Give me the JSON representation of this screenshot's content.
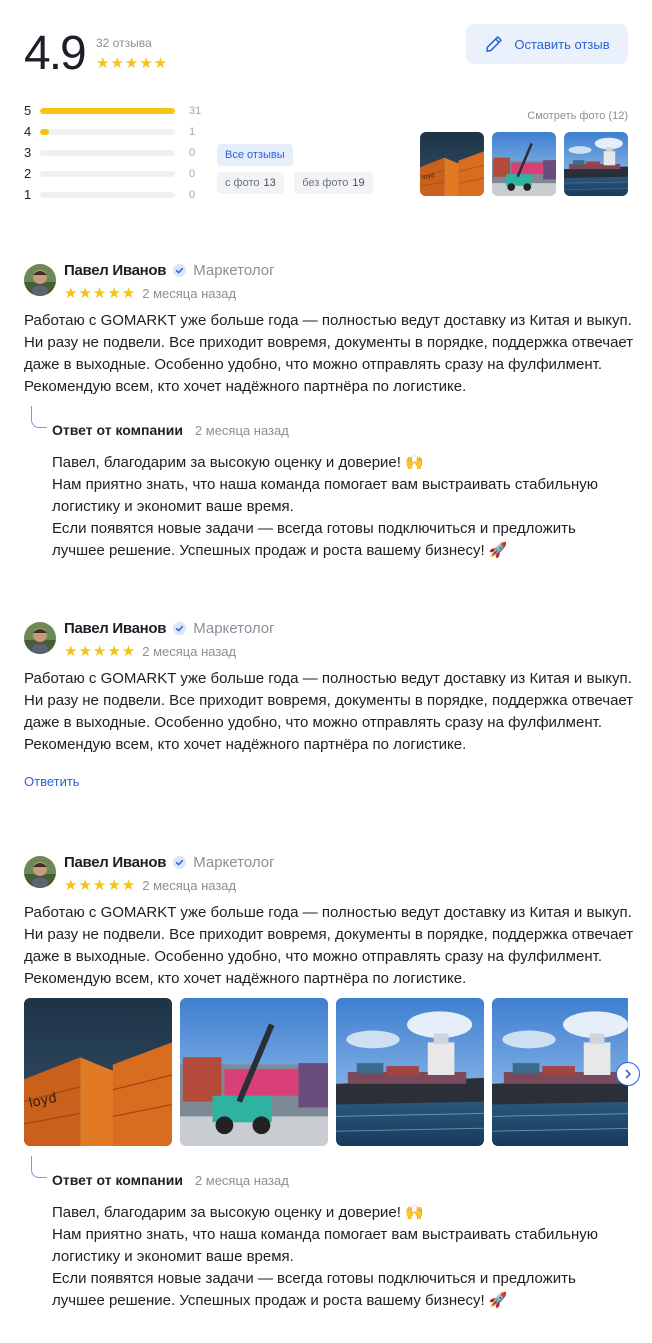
{
  "summary": {
    "rating": "4.9",
    "review_count": "32 отзыва",
    "stars": "★★★★★",
    "leave_review_label": "Оставить отзыв",
    "distribution": [
      {
        "stars": "5",
        "count": "31",
        "fill": 1.0
      },
      {
        "stars": "4",
        "count": "1",
        "fill": 0.07
      },
      {
        "stars": "3",
        "count": "0",
        "fill": 0
      },
      {
        "stars": "2",
        "count": "0",
        "fill": 0
      },
      {
        "stars": "1",
        "count": "0",
        "fill": 0
      }
    ],
    "filters": {
      "all": "Все отзывы",
      "with_photo": "с фото",
      "with_photo_count": "13",
      "without_photo": "без фото",
      "without_photo_count": "19"
    },
    "see_photos": "Смотреть фото (12)"
  },
  "reviews": [
    {
      "author": "Павел Иванов",
      "role": "Маркетолог",
      "stars": "★★★★★",
      "date": "2 месяца назад",
      "text": "Работаю с GOMARKT уже больше года — полностью ведут доставку из Китая и выкуп. Ни разу не подвели. Все приходит вовремя, документы в порядке, поддержка отвечает даже в выходные. Особенно удобно, что можно отправлять сразу на фулфилмент. Рекомендую всем, кто хочет надёжного партнёра по логистике.",
      "reply": {
        "title": "Ответ от компании",
        "date": "2 месяца назад",
        "lines": [
          "Павел, благодарим за высокую оценку и доверие! 🙌",
          "Нам приятно знать, что наша команда помогает вам выстраивать стабильную",
          "логистику и экономит ваше время.",
          "Если появятся новые задачи — всегда готовы подключиться и предложить",
          "лучшее решение. Успешных продаж и роста вашему бизнесу! 🚀"
        ]
      }
    },
    {
      "author": "Павел Иванов",
      "role": "Маркетолог",
      "stars": "★★★★★",
      "date": "2 месяца назад",
      "text": "Работаю с GOMARKT уже больше года — полностью ведут доставку из Китая и выкуп. Ни разу не подвели. Все приходит вовремя, документы в порядке, поддержка отвечает даже в выходные. Особенно удобно, что можно отправлять сразу на фулфилмент. Рекомендую всем, кто хочет надёжного партнёра по логистике.",
      "answer_label": "Ответить"
    },
    {
      "author": "Павел Иванов",
      "role": "Маркетолог",
      "stars": "★★★★★",
      "date": "2 месяца назад",
      "text": "Работаю с GOMARKT уже больше года — полностью ведут доставку из Китая и выкуп. Ни разу не подвели. Все приходит вовремя, документы в порядке, поддержка отвечает даже в выходные. Особенно удобно, что можно отправлять сразу на фулфилмент. Рекомендую всем, кто хочет надёжного партнёра по логистике.",
      "reply": {
        "title": "Ответ от компании",
        "date": "2 месяца назад",
        "lines": [
          "Павел, благодарим за высокую оценку и доверие! 🙌",
          "Нам приятно знать, что наша команда помогает вам выстраивать стабильную",
          "логистику и экономит ваше время.",
          "Если появятся новые задачи — всегда готовы подключиться и предложить",
          "лучшее решение. Успешных продаж и роста вашему бизнесу! 🚀"
        ]
      }
    }
  ],
  "colors": {
    "accent": "#2a63d4",
    "star": "#f6c313",
    "muted": "#8a8f99"
  },
  "icons": [
    "pencil-icon",
    "verified-icon",
    "chevron-right-icon"
  ]
}
